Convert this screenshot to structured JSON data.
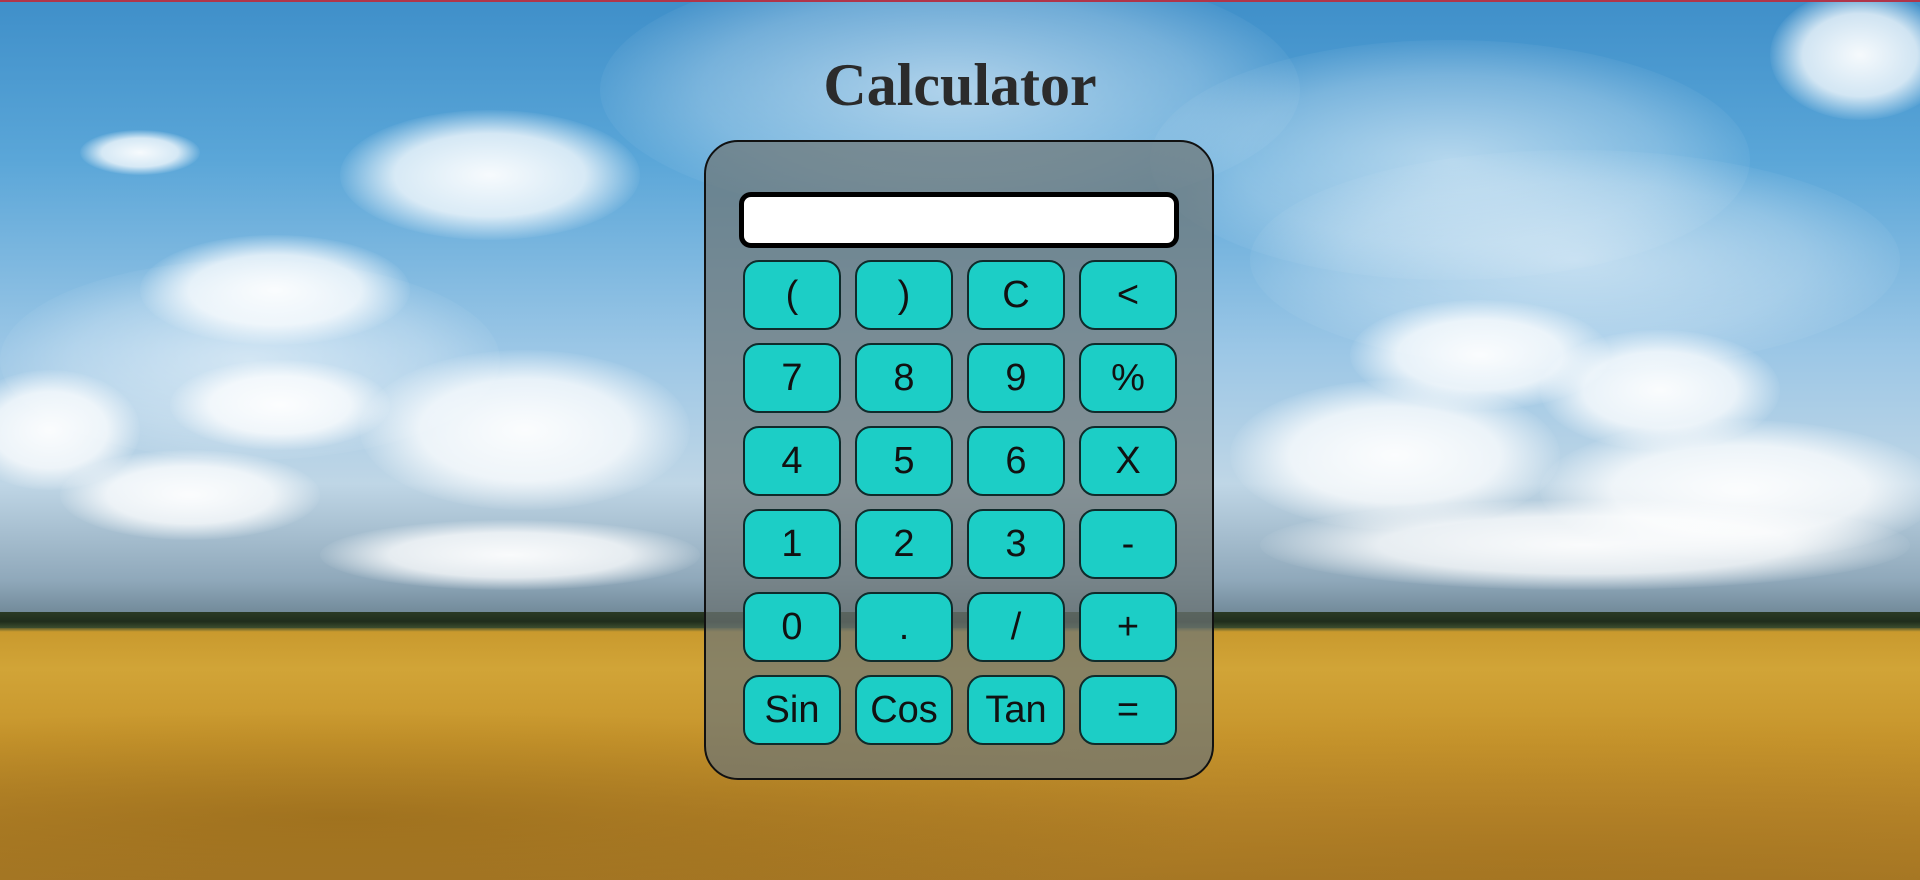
{
  "page": {
    "title": "Calculator"
  },
  "calculator": {
    "display_value": "",
    "keys": [
      {
        "label": "(",
        "name": "open-paren-button"
      },
      {
        "label": ")",
        "name": "close-paren-button"
      },
      {
        "label": "C",
        "name": "clear-button"
      },
      {
        "label": "<",
        "name": "backspace-button"
      },
      {
        "label": "7",
        "name": "digit-7-button"
      },
      {
        "label": "8",
        "name": "digit-8-button"
      },
      {
        "label": "9",
        "name": "digit-9-button"
      },
      {
        "label": "%",
        "name": "percent-button"
      },
      {
        "label": "4",
        "name": "digit-4-button"
      },
      {
        "label": "5",
        "name": "digit-5-button"
      },
      {
        "label": "6",
        "name": "digit-6-button"
      },
      {
        "label": "X",
        "name": "multiply-button"
      },
      {
        "label": "1",
        "name": "digit-1-button"
      },
      {
        "label": "2",
        "name": "digit-2-button"
      },
      {
        "label": "3",
        "name": "digit-3-button"
      },
      {
        "label": "-",
        "name": "subtract-button"
      },
      {
        "label": "0",
        "name": "digit-0-button"
      },
      {
        "label": ".",
        "name": "decimal-button"
      },
      {
        "label": "/",
        "name": "divide-button"
      },
      {
        "label": "+",
        "name": "add-button"
      },
      {
        "label": "Sin",
        "name": "sin-button"
      },
      {
        "label": "Cos",
        "name": "cos-button"
      },
      {
        "label": "Tan",
        "name": "tan-button"
      },
      {
        "label": "=",
        "name": "equals-button"
      }
    ]
  },
  "colors": {
    "key_background": "#1ccec6",
    "panel_background": "#6e7676",
    "title_text": "#2b2b2b"
  }
}
